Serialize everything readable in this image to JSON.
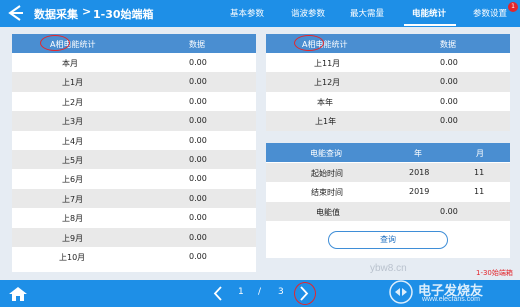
{
  "header": {
    "title": "数据采集",
    "chevron": ">",
    "subtitle": "1-30始端箱",
    "tabs": [
      {
        "label": "基本参数"
      },
      {
        "label": "谐波参数"
      },
      {
        "label": "最大需量"
      },
      {
        "label": "电能统计"
      },
      {
        "label": "参数设置"
      }
    ],
    "badge": "1"
  },
  "left_table": {
    "headers": [
      "A相电能统计",
      "数据"
    ],
    "rows": [
      {
        "label": "本月",
        "value": "0.00"
      },
      {
        "label": "上1月",
        "value": "0.00"
      },
      {
        "label": "上2月",
        "value": "0.00"
      },
      {
        "label": "上3月",
        "value": "0.00"
      },
      {
        "label": "上4月",
        "value": "0.00"
      },
      {
        "label": "上5月",
        "value": "0.00"
      },
      {
        "label": "上6月",
        "value": "0.00"
      },
      {
        "label": "上7月",
        "value": "0.00"
      },
      {
        "label": "上8月",
        "value": "0.00"
      },
      {
        "label": "上9月",
        "value": "0.00"
      },
      {
        "label": "上10月",
        "value": "0.00"
      }
    ]
  },
  "right_table": {
    "headers": [
      "A相电能统计",
      "数据"
    ],
    "rows": [
      {
        "label": "上11月",
        "value": "0.00"
      },
      {
        "label": "上12月",
        "value": "0.00"
      },
      {
        "label": "本年",
        "value": "0.00"
      },
      {
        "label": "上1年",
        "value": "0.00"
      }
    ]
  },
  "query_panel": {
    "headers": [
      "电能查询",
      "年",
      "月"
    ],
    "start_label": "起始时间",
    "start_year": "2018",
    "start_month": "11",
    "end_label": "结束时间",
    "end_year": "2019",
    "end_month": "11",
    "value_label": "电能值",
    "value": "0.00",
    "button_label": "查询"
  },
  "pager": {
    "current": "1",
    "separator": "/",
    "total": "3"
  },
  "status_text": "1-30始端箱",
  "watermark": {
    "text": "电子发烧友",
    "url": "www.elecfans.com",
    "user": "ybw8.cn"
  },
  "colors": {
    "header_bg": "#1e8fe7",
    "table_header_bg": "#4a8ed1",
    "annotation": "#e3262c"
  }
}
